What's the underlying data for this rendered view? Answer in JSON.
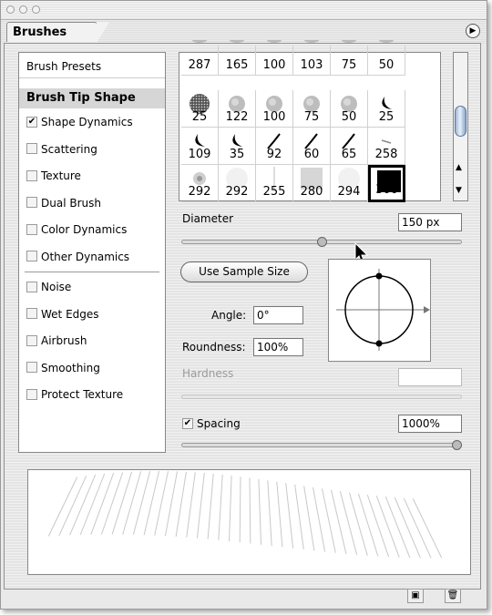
{
  "panel": {
    "tab_title": "Brushes"
  },
  "left_list": {
    "preset_label": "Brush Presets",
    "tip_shape_label": "Brush Tip Shape",
    "options": [
      {
        "label": "Shape Dynamics",
        "checked": true
      },
      {
        "label": "Scattering",
        "checked": false
      },
      {
        "label": "Texture",
        "checked": false
      },
      {
        "label": "Dual Brush",
        "checked": false
      },
      {
        "label": "Color Dynamics",
        "checked": false
      },
      {
        "label": "Other Dynamics",
        "checked": false
      }
    ],
    "extras": [
      {
        "label": "Noise",
        "checked": false
      },
      {
        "label": "Wet Edges",
        "checked": false
      },
      {
        "label": "Airbrush",
        "checked": false
      },
      {
        "label": "Smoothing",
        "checked": false
      },
      {
        "label": "Protect  Texture",
        "checked": false
      }
    ]
  },
  "brush_grid": {
    "rows": [
      [
        {
          "n": "287",
          "t": "none"
        },
        {
          "n": "165",
          "t": "none"
        },
        {
          "n": "100",
          "t": "none"
        },
        {
          "n": "103",
          "t": "none"
        },
        {
          "n": "75",
          "t": "none"
        },
        {
          "n": "50",
          "t": "none"
        }
      ],
      [
        {
          "n": "25",
          "t": "texture"
        },
        {
          "n": "122",
          "t": "soft"
        },
        {
          "n": "100",
          "t": "soft"
        },
        {
          "n": "75",
          "t": "soft"
        },
        {
          "n": "50",
          "t": "soft"
        },
        {
          "n": "25",
          "t": "crescent"
        }
      ],
      [
        {
          "n": "109",
          "t": "crescent"
        },
        {
          "n": "35",
          "t": "crescent"
        },
        {
          "n": "92",
          "t": "stroke"
        },
        {
          "n": "60",
          "t": "stroke"
        },
        {
          "n": "65",
          "t": "stroke"
        },
        {
          "n": "258",
          "t": "dash"
        }
      ],
      [
        {
          "n": "292",
          "t": "swirl"
        },
        {
          "n": "292",
          "t": "faint"
        },
        {
          "n": "255",
          "t": "line"
        },
        {
          "n": "280",
          "t": "grey"
        },
        {
          "n": "294",
          "t": "faint"
        },
        {
          "n": "300",
          "t": "solid",
          "selected": true
        }
      ]
    ]
  },
  "diameter": {
    "label": "Diameter",
    "value": "150 px",
    "level": 0.5
  },
  "use_sample_size_label": "Use Sample Size",
  "angle": {
    "label": "Angle:",
    "value": "0°"
  },
  "roundness": {
    "label": "Roundness:",
    "value": "100%"
  },
  "hardness": {
    "label": "Hardness",
    "value": ""
  },
  "spacing": {
    "label": "Spacing",
    "checked": true,
    "value": "1000%",
    "level": 1.0
  },
  "icons": {
    "menu": "triangle-right-icon",
    "new": "new-brush-icon",
    "trash": "trash-icon"
  }
}
